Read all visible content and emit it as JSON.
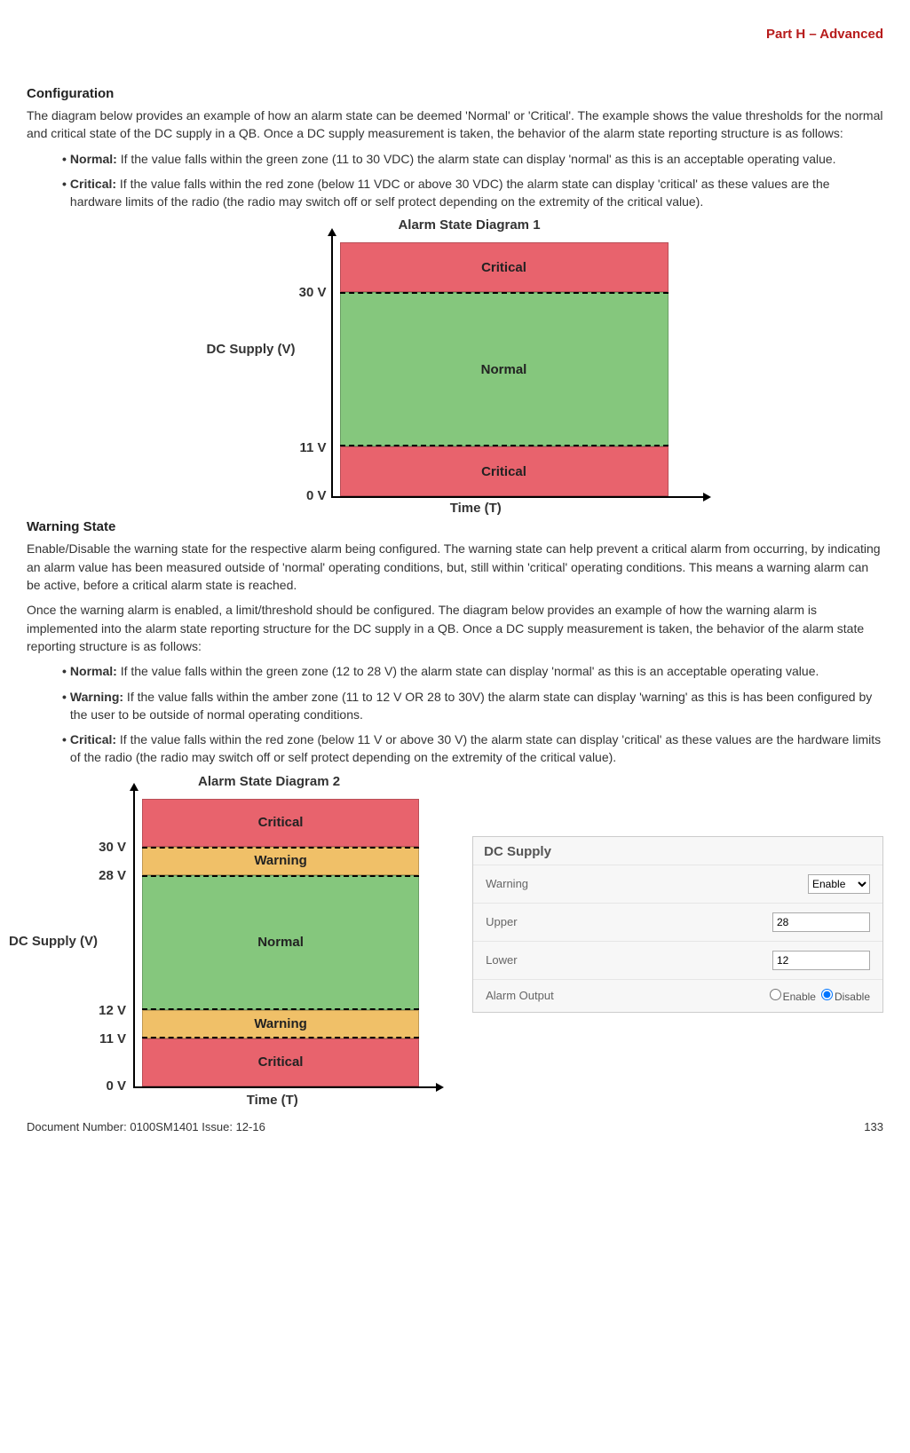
{
  "header": {
    "part": "Part H – Advanced"
  },
  "section1": {
    "title": "Configuration",
    "intro": "The diagram below provides an example of how an alarm state can be deemed 'Normal' or 'Critical'. The example shows the value thresholds for the normal and critical state of the DC supply in a QB. Once a DC supply measurement is taken, the behavior of the alarm state reporting structure is as follows:",
    "bullets": [
      {
        "label": "Normal:",
        "text": " If the value falls within the green zone (11 to 30 VDC) the alarm state can display 'normal' as this is an acceptable operating value."
      },
      {
        "label": "Critical:",
        "text": " If the value falls within the red zone (below 11 VDC or above 30 VDC) the alarm state can display 'critical' as these values are the hardware limits of the radio (the radio may switch off or self protect depending on the extremity of the critical value)."
      }
    ]
  },
  "diagram1": {
    "title": "Alarm State Diagram 1",
    "ylabel": "DC Supply (V)",
    "xlabel": "Time (T)",
    "ticks": {
      "t30": "30 V",
      "t11": "11 V",
      "t0": "0 V"
    },
    "bands": {
      "critical": "Critical",
      "normal": "Normal"
    }
  },
  "section2": {
    "title": "Warning State",
    "p1": "Enable/Disable the warning state for the respective alarm being configured. The warning state can help prevent a critical alarm from occurring, by indicating an alarm value has been measured outside of 'normal' operating conditions, but, still within 'critical' operating conditions. This means a warning alarm can be active, before a critical alarm state is reached.",
    "p2": "Once the warning alarm is enabled, a limit/threshold should be configured. The diagram below provides an example of how the warning alarm is implemented into the alarm state reporting structure for the DC supply in a QB. Once a DC supply measurement is taken, the behavior of the alarm state reporting structure is as follows:",
    "bullets": [
      {
        "label": "Normal:",
        "text": " If the value falls within the green zone (12 to 28 V) the alarm state can display 'normal' as this is an acceptable operating value."
      },
      {
        "label": "Warning:",
        "text": " If the value falls within the amber zone (11 to 12 V OR 28 to 30V) the alarm state can display 'warning' as this is has been configured by the user to be outside of normal operating conditions."
      },
      {
        "label": "Critical:",
        "text": " If the value falls within the red zone (below 11 V or above 30 V) the alarm state can display 'critical' as these values are the hardware limits of the radio (the radio may switch off or self protect depending on the extremity of the critical value)."
      }
    ]
  },
  "diagram2": {
    "title": "Alarm State Diagram 2",
    "ylabel": "DC Supply (V)",
    "xlabel": "Time (T)",
    "ticks": {
      "t30": "30 V",
      "t28": "28 V",
      "t12": "12 V",
      "t11": "11 V",
      "t0": "0 V"
    },
    "bands": {
      "critical": "Critical",
      "warning": "Warning",
      "normal": "Normal"
    }
  },
  "panel": {
    "title": "DC Supply",
    "rows": {
      "warning": "Warning",
      "upper": "Upper",
      "lower": "Lower",
      "alarmOutput": "Alarm Output"
    },
    "values": {
      "warningSelect": "Enable",
      "upper": "28",
      "lower": "12",
      "enable": "Enable",
      "disable": "Disable"
    }
  },
  "footer": {
    "doc": "Document Number: 0100SM1401   Issue: 12-16",
    "page": "133"
  },
  "chart_data": [
    {
      "type": "area",
      "title": "Alarm State Diagram 1",
      "xlabel": "Time (T)",
      "ylabel": "DC Supply (V)",
      "ylim": [
        0,
        35
      ],
      "bands": [
        {
          "name": "Critical",
          "range": [
            30,
            35
          ],
          "color": "#e8636d"
        },
        {
          "name": "Normal",
          "range": [
            11,
            30
          ],
          "color": "#85c77d"
        },
        {
          "name": "Critical",
          "range": [
            0,
            11
          ],
          "color": "#e8636d"
        }
      ],
      "thresholds": [
        11,
        30
      ]
    },
    {
      "type": "area",
      "title": "Alarm State Diagram 2",
      "xlabel": "Time (T)",
      "ylabel": "DC Supply (V)",
      "ylim": [
        0,
        35
      ],
      "bands": [
        {
          "name": "Critical",
          "range": [
            30,
            35
          ],
          "color": "#e8636d"
        },
        {
          "name": "Warning",
          "range": [
            28,
            30
          ],
          "color": "#f0c068"
        },
        {
          "name": "Normal",
          "range": [
            12,
            28
          ],
          "color": "#85c77d"
        },
        {
          "name": "Warning",
          "range": [
            11,
            12
          ],
          "color": "#f0c068"
        },
        {
          "name": "Critical",
          "range": [
            0,
            11
          ],
          "color": "#e8636d"
        }
      ],
      "thresholds": [
        11,
        12,
        28,
        30
      ]
    }
  ]
}
